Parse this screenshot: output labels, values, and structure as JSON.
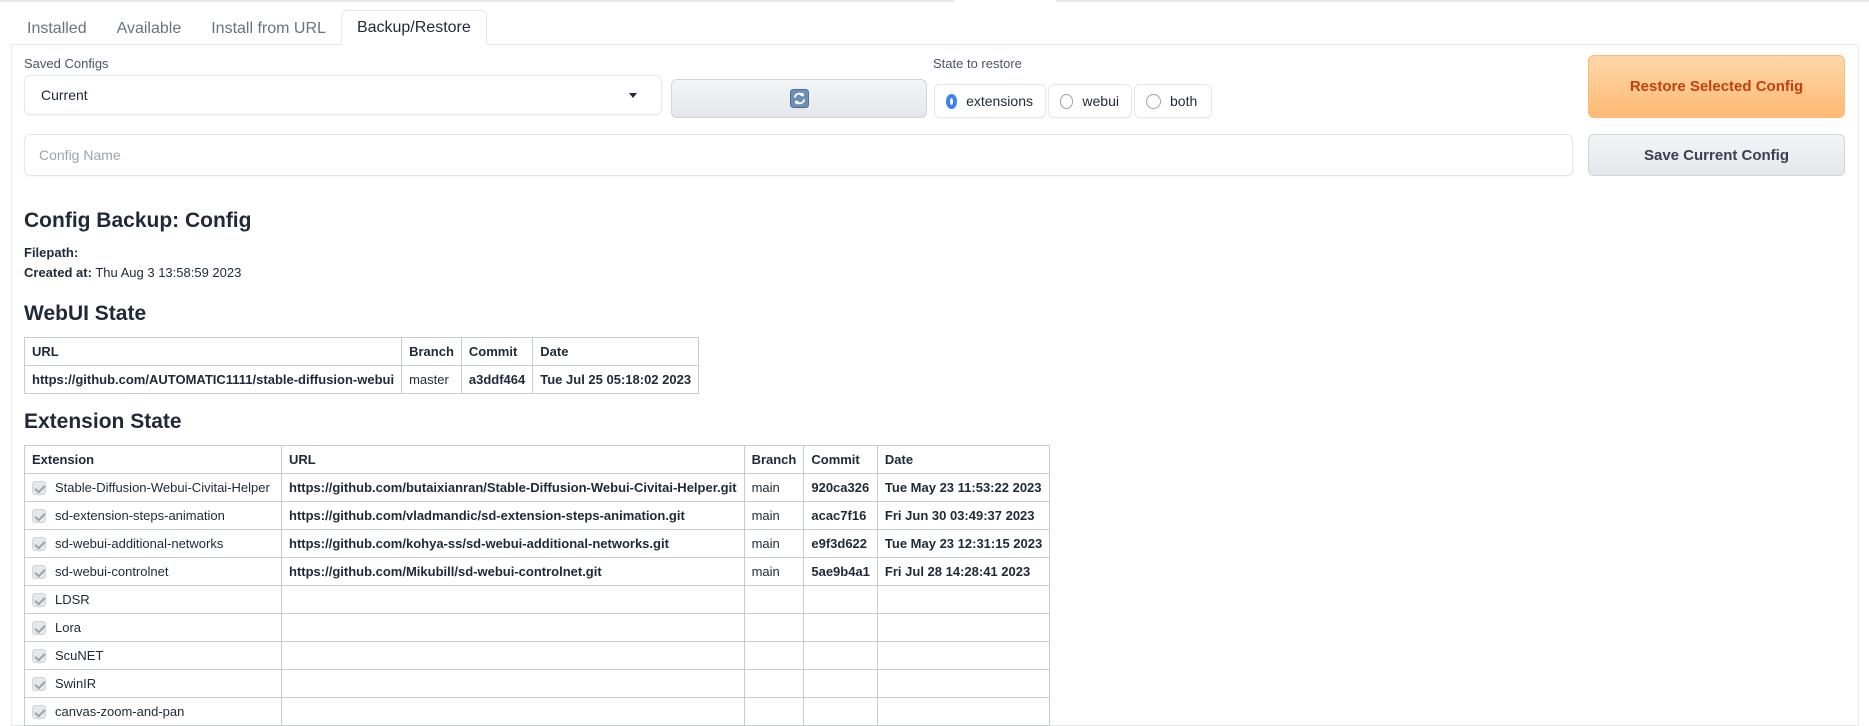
{
  "tabs": [
    "Installed",
    "Available",
    "Install from URL",
    "Backup/Restore"
  ],
  "active_tab": "Backup/Restore",
  "saved_configs": {
    "label": "Saved Configs",
    "value": "Current"
  },
  "state_to_restore": {
    "label": "State to restore",
    "options": [
      "extensions",
      "webui",
      "both"
    ],
    "selected": "extensions"
  },
  "restore_button": "Restore Selected Config",
  "config_name": {
    "placeholder": "Config Name",
    "value": ""
  },
  "save_button": "Save Current Config",
  "backup": {
    "title": "Config Backup: Config",
    "filepath_label": "Filepath:",
    "filepath": "",
    "created_label": "Created at:",
    "created": "Thu Aug 3 13:58:59 2023"
  },
  "webui_state": {
    "title": "WebUI State",
    "headers": [
      "URL",
      "Branch",
      "Commit",
      "Date"
    ],
    "row": {
      "url": "https://github.com/AUTOMATIC1111/stable-diffusion-webui",
      "branch": "master",
      "commit": "a3ddf464",
      "date": "Tue Jul 25 05:18:02 2023"
    }
  },
  "extension_state": {
    "title": "Extension State",
    "headers": [
      "Extension",
      "URL",
      "Branch",
      "Commit",
      "Date"
    ],
    "rows": [
      {
        "name": "Stable-Diffusion-Webui-Civitai-Helper",
        "url": "https://github.com/butaixianran/Stable-Diffusion-Webui-Civitai-Helper.git",
        "branch": "main",
        "commit": "920ca326",
        "date": "Tue May 23 11:53:22 2023"
      },
      {
        "name": "sd-extension-steps-animation",
        "url": "https://github.com/vladmandic/sd-extension-steps-animation.git",
        "branch": "main",
        "commit": "acac7f16",
        "date": "Fri Jun 30 03:49:37 2023"
      },
      {
        "name": "sd-webui-additional-networks",
        "url": "https://github.com/kohya-ss/sd-webui-additional-networks.git",
        "branch": "main",
        "commit": "e9f3d622",
        "date": "Tue May 23 12:31:15 2023"
      },
      {
        "name": "sd-webui-controlnet",
        "url": "https://github.com/Mikubill/sd-webui-controlnet.git",
        "branch": "main",
        "commit": "5ae9b4a1",
        "date": "Fri Jul 28 14:28:41 2023"
      },
      {
        "name": "LDSR",
        "url": "",
        "branch": "",
        "commit": "",
        "date": ""
      },
      {
        "name": "Lora",
        "url": "",
        "branch": "",
        "commit": "",
        "date": ""
      },
      {
        "name": "ScuNET",
        "url": "",
        "branch": "",
        "commit": "",
        "date": ""
      },
      {
        "name": "SwinIR",
        "url": "",
        "branch": "",
        "commit": "",
        "date": ""
      },
      {
        "name": "canvas-zoom-and-pan",
        "url": "",
        "branch": "",
        "commit": "",
        "date": ""
      }
    ]
  }
}
